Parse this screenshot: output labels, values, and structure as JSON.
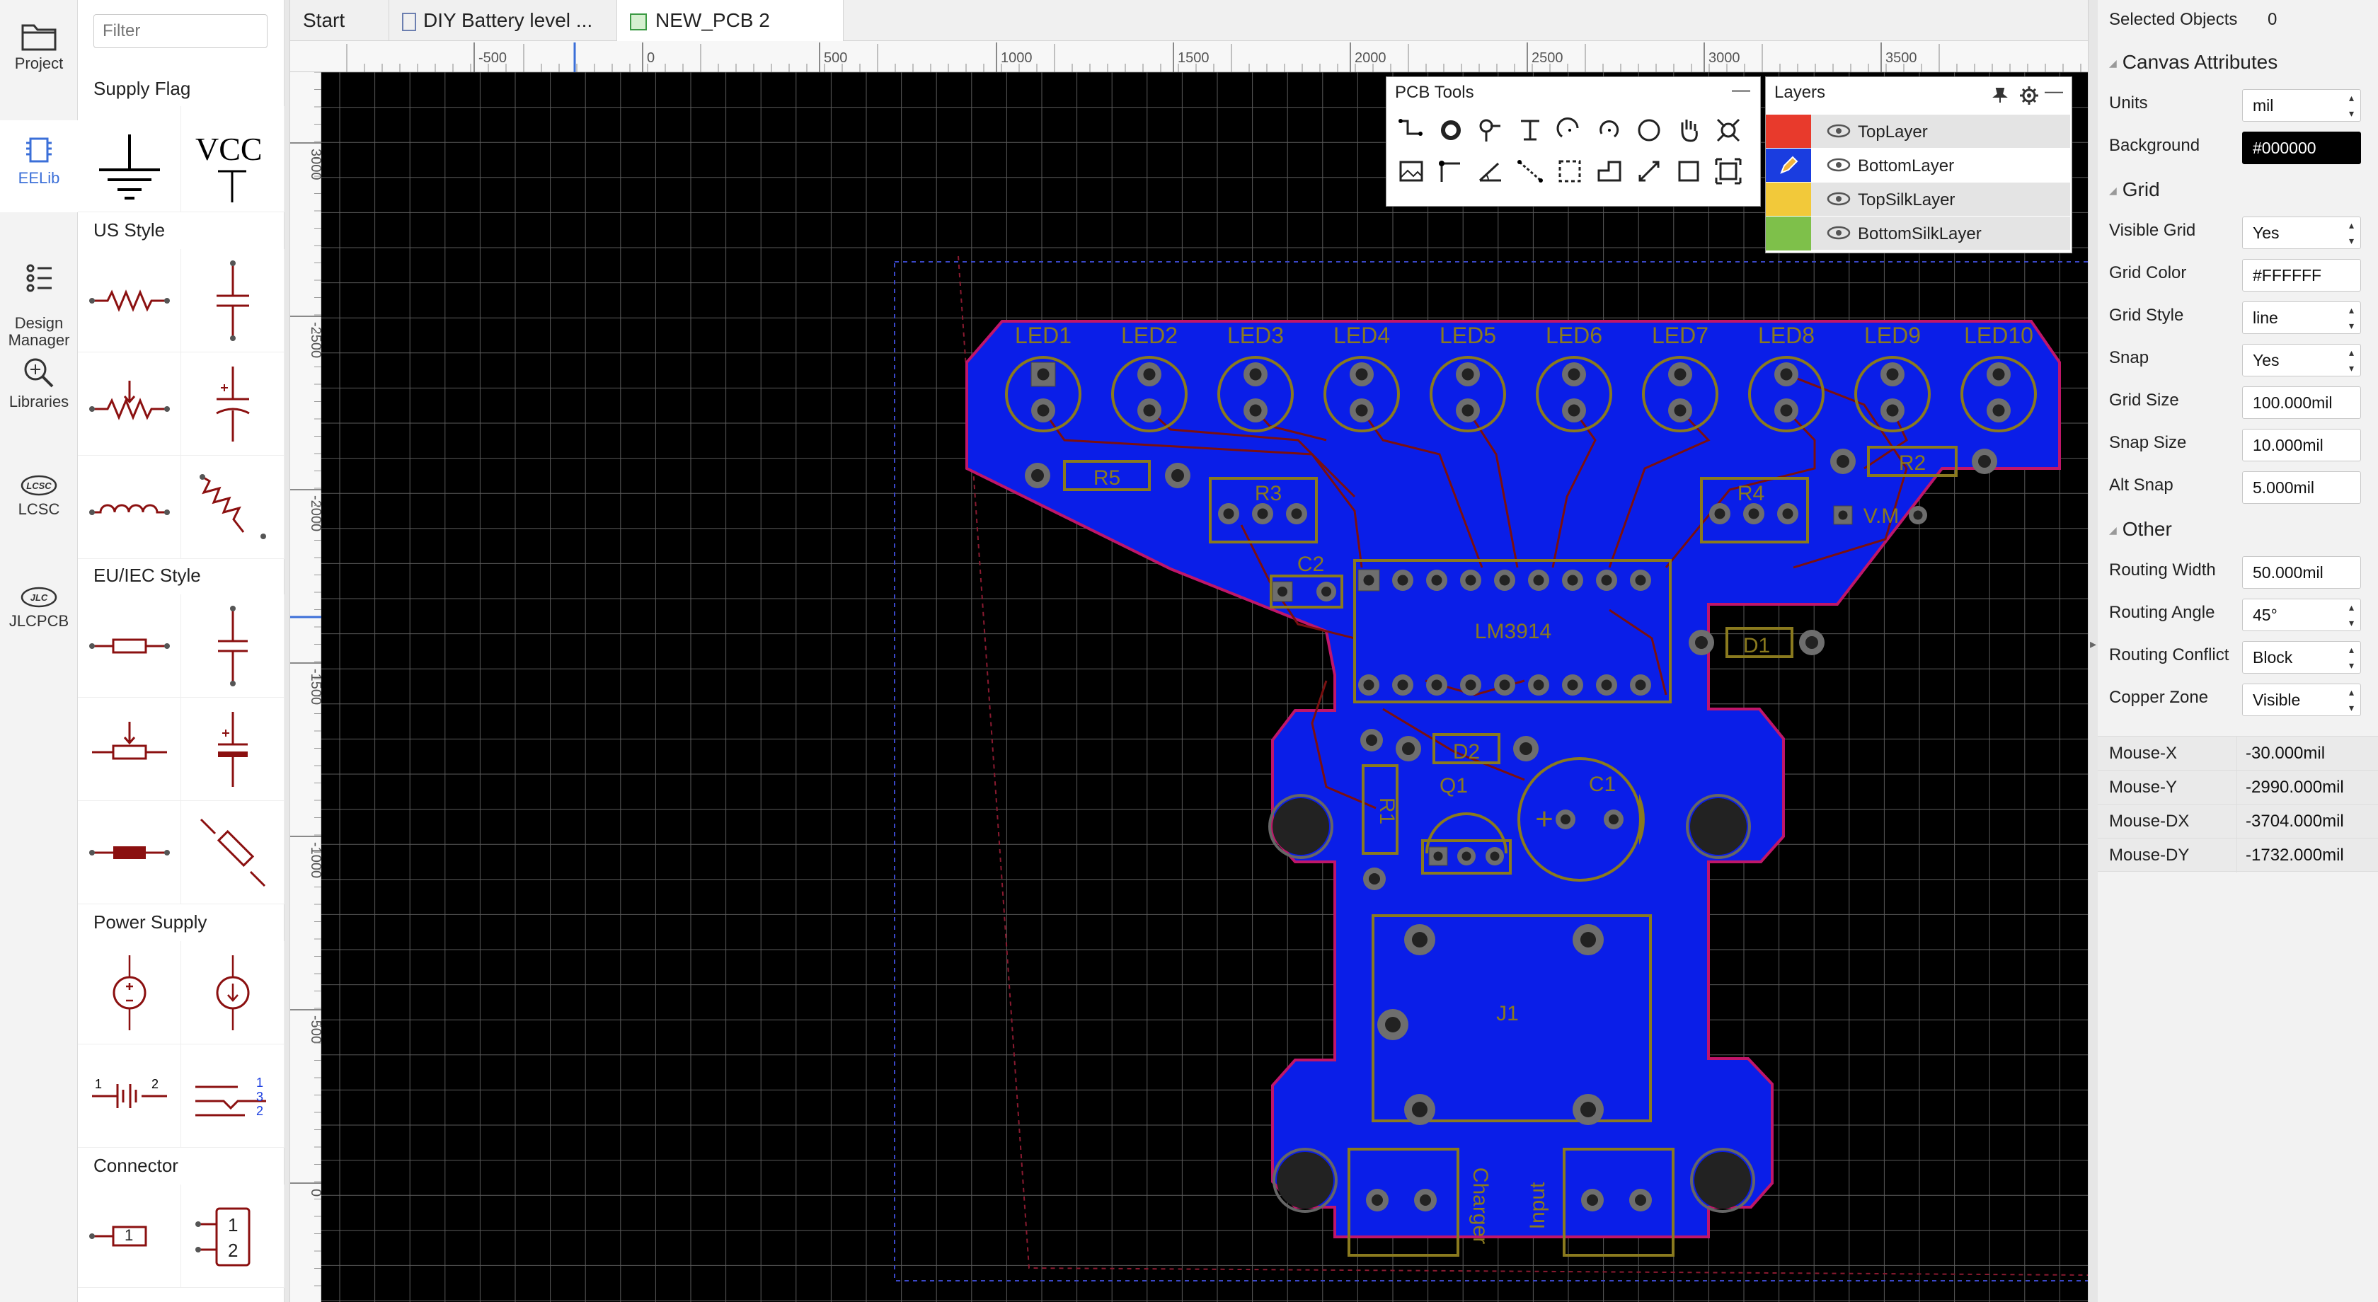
{
  "nav": {
    "items": [
      {
        "label": "Project",
        "icon": "folder-icon"
      },
      {
        "label": "EELib",
        "icon": "chip-icon"
      },
      {
        "label": "Design\nManager",
        "icon": "list-icon"
      },
      {
        "label": "Libraries",
        "icon": "library-search-icon"
      },
      {
        "label": "LCSC",
        "icon": "lcsc-logo"
      },
      {
        "label": "JLCPCB",
        "icon": "jlc-logo"
      }
    ]
  },
  "library": {
    "filter_placeholder": "Filter",
    "sections": {
      "supply_flag": "Supply Flag",
      "us_style": "US Style",
      "euiec_style": "EU/IEC Style",
      "power_supply": "Power Supply",
      "connector": "Connector"
    },
    "vcc_label": "VCC",
    "connector_pins_1": "1",
    "connector_pins_2a": "1",
    "connector_pins_2b": "2"
  },
  "tabs": [
    {
      "label": "Start"
    },
    {
      "label": "DIY Battery level ..."
    },
    {
      "label": "NEW_PCB 2"
    }
  ],
  "ruler": {
    "top": [
      "-500",
      "0",
      "500",
      "1000",
      "1500",
      "2000",
      "2500",
      "3000",
      "3500"
    ],
    "left": [
      "3000",
      "-2500",
      "-2000",
      "-1500",
      "-1000",
      "-500",
      "0"
    ]
  },
  "pcb_tools": {
    "title": "PCB Tools",
    "minimize": "—"
  },
  "layers": {
    "title": "Layers",
    "items": [
      {
        "name": "TopLayer",
        "color": "#e83a2c"
      },
      {
        "name": "BottomLayer",
        "color": "#1a3de0"
      },
      {
        "name": "TopSilkLayer",
        "color": "#f2c93a"
      },
      {
        "name": "BottomSilkLayer",
        "color": "#7ec04a"
      }
    ]
  },
  "props": {
    "selected_label": "Selected Objects",
    "selected_count": "0",
    "canvas_header": "Canvas Attributes",
    "units_label": "Units",
    "units": "mil",
    "background_label": "Background",
    "background": "#000000",
    "grid_header": "Grid",
    "visible_grid_label": "Visible Grid",
    "visible_grid": "Yes",
    "grid_color_label": "Grid Color",
    "grid_color": "#FFFFFF",
    "grid_style_label": "Grid Style",
    "grid_style": "line",
    "snap_label": "Snap",
    "snap": "Yes",
    "grid_size_label": "Grid Size",
    "grid_size": "100.000mil",
    "snap_size_label": "Snap Size",
    "snap_size": "10.000mil",
    "alt_snap_label": "Alt Snap",
    "alt_snap": "5.000mil",
    "other_header": "Other",
    "routing_width_label": "Routing Width",
    "routing_width": "50.000mil",
    "routing_angle_label": "Routing Angle",
    "routing_angle": "45°",
    "routing_conflict_label": "Routing Conflict",
    "routing_conflict": "Block",
    "copper_zone_label": "Copper Zone",
    "copper_zone": "Visible",
    "mouse_x_label": "Mouse-X",
    "mouse_x": "-30.000mil",
    "mouse_y_label": "Mouse-Y",
    "mouse_y": "-2990.000mil",
    "mouse_dx_label": "Mouse-DX",
    "mouse_dx": "-3704.000mil",
    "mouse_dy_label": "Mouse-DY",
    "mouse_dy": "-1732.000mil"
  },
  "pcb": {
    "leds": [
      "LED1",
      "LED2",
      "LED3",
      "LED4",
      "LED5",
      "LED6",
      "LED7",
      "LED8",
      "LED9",
      "LED10"
    ],
    "r5": "R5",
    "r3": "R3",
    "r4": "R4",
    "r2": "R2",
    "c2": "C2",
    "lm": "LM3914",
    "d1": "D1",
    "d2": "D2",
    "vm": "V.M",
    "q1": "Q1",
    "c1": "C1",
    "r1": "R1",
    "j1": "J1",
    "charger": "Charger",
    "input": "Input",
    "colors": {
      "copper": "#0a1ee8",
      "outline": "#c0166a",
      "silk": "#8a7a1e",
      "pad": "#6e6e6e",
      "board_bg": "#000000"
    }
  }
}
